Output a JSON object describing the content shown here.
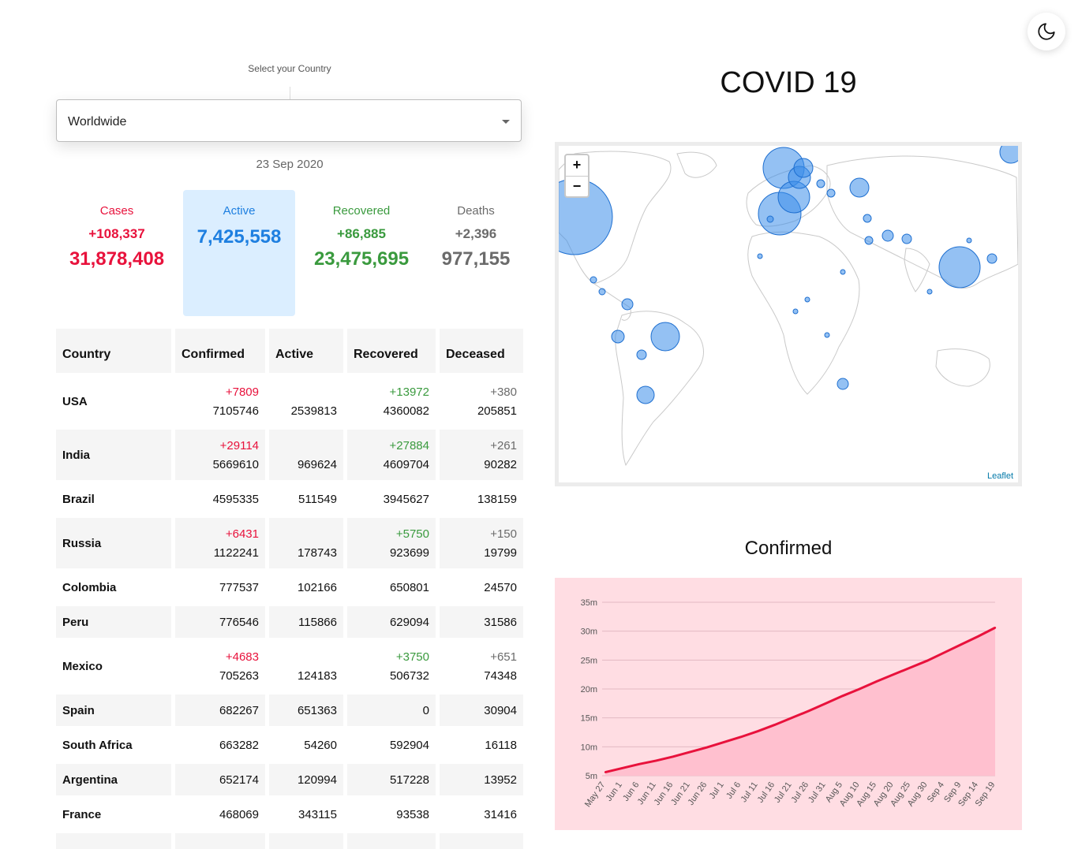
{
  "theme_toggle": {
    "icon": "moon-icon"
  },
  "selector": {
    "label": "Select your Country",
    "value": "Worldwide"
  },
  "date": "23 Sep 2020",
  "stats": {
    "cases": {
      "title": "Cases",
      "change": "+108,337",
      "total": "31,878,408",
      "color": "#e8123c"
    },
    "active": {
      "title": "Active",
      "total": "7,425,558",
      "color": "#1e7fe0"
    },
    "recovered": {
      "title": "Recovered",
      "change": "+86,885",
      "total": "23,475,695",
      "color": "#3a9a3e"
    },
    "deaths": {
      "title": "Deaths",
      "change": "+2,396",
      "total": "977,155",
      "color": "#6b6b6b"
    }
  },
  "table": {
    "headers": [
      "Country",
      "Confirmed",
      "Active",
      "Recovered",
      "Deceased"
    ],
    "rows": [
      {
        "country": "USA",
        "confirmed": "7105746",
        "confirmed_change": "+7809",
        "active": "2539813",
        "recovered": "4360082",
        "recovered_change": "+13972",
        "deceased": "205851",
        "deceased_change": "+380"
      },
      {
        "country": "India",
        "confirmed": "5669610",
        "confirmed_change": "+29114",
        "active": "969624",
        "recovered": "4609704",
        "recovered_change": "+27884",
        "deceased": "90282",
        "deceased_change": "+261"
      },
      {
        "country": "Brazil",
        "confirmed": "4595335",
        "confirmed_change": "",
        "active": "511549",
        "recovered": "3945627",
        "recovered_change": "",
        "deceased": "138159",
        "deceased_change": ""
      },
      {
        "country": "Russia",
        "confirmed": "1122241",
        "confirmed_change": "+6431",
        "active": "178743",
        "recovered": "923699",
        "recovered_change": "+5750",
        "deceased": "19799",
        "deceased_change": "+150"
      },
      {
        "country": "Colombia",
        "confirmed": "777537",
        "confirmed_change": "",
        "active": "102166",
        "recovered": "650801",
        "recovered_change": "",
        "deceased": "24570",
        "deceased_change": ""
      },
      {
        "country": "Peru",
        "confirmed": "776546",
        "confirmed_change": "",
        "active": "115866",
        "recovered": "629094",
        "recovered_change": "",
        "deceased": "31586",
        "deceased_change": ""
      },
      {
        "country": "Mexico",
        "confirmed": "705263",
        "confirmed_change": "+4683",
        "active": "124183",
        "recovered": "506732",
        "recovered_change": "+3750",
        "deceased": "74348",
        "deceased_change": "+651"
      },
      {
        "country": "Spain",
        "confirmed": "682267",
        "confirmed_change": "",
        "active": "651363",
        "recovered": "0",
        "recovered_change": "",
        "deceased": "30904",
        "deceased_change": ""
      },
      {
        "country": "South Africa",
        "confirmed": "663282",
        "confirmed_change": "",
        "active": "54260",
        "recovered": "592904",
        "recovered_change": "",
        "deceased": "16118",
        "deceased_change": ""
      },
      {
        "country": "Argentina",
        "confirmed": "652174",
        "confirmed_change": "",
        "active": "120994",
        "recovered": "517228",
        "recovered_change": "",
        "deceased": "13952",
        "deceased_change": ""
      },
      {
        "country": "France",
        "confirmed": "468069",
        "confirmed_change": "",
        "active": "343115",
        "recovered": "93538",
        "recovered_change": "",
        "deceased": "31416",
        "deceased_change": ""
      }
    ]
  },
  "title": "COVID 19",
  "map": {
    "zoom_in": "+",
    "zoom_out": "−",
    "attribution": "Leaflet",
    "bubble_color": "#3d8eea"
  },
  "chart_title": "Confirmed",
  "chart_data": {
    "type": "area",
    "x": [
      "May 27",
      "Jun 1",
      "Jun 6",
      "Jun 11",
      "Jun 16",
      "Jun 21",
      "Jun 26",
      "Jul 1",
      "Jul 6",
      "Jul 11",
      "Jul 16",
      "Jul 21",
      "Jul 26",
      "Jul 31",
      "Aug 5",
      "Aug 10",
      "Aug 15",
      "Aug 20",
      "Aug 25",
      "Aug 30",
      "Sep 4",
      "Sep 9",
      "Sep 14",
      "Sep 19"
    ],
    "series": [
      {
        "values": [
          5.6,
          6.3,
          7.0,
          7.6,
          8.3,
          9.1,
          9.9,
          10.8,
          11.7,
          12.7,
          13.8,
          15.0,
          16.2,
          17.5,
          18.8,
          20.0,
          21.3,
          22.5,
          23.7,
          24.9,
          26.3,
          27.7,
          29.1,
          30.6
        ]
      }
    ],
    "y_ticks": [
      "5m",
      "10m",
      "15m",
      "20m",
      "25m",
      "30m",
      "35m"
    ],
    "ylim": [
      5,
      35
    ],
    "line_color": "#e8123c",
    "fill_color": "#ffc0cf",
    "grid": true
  }
}
